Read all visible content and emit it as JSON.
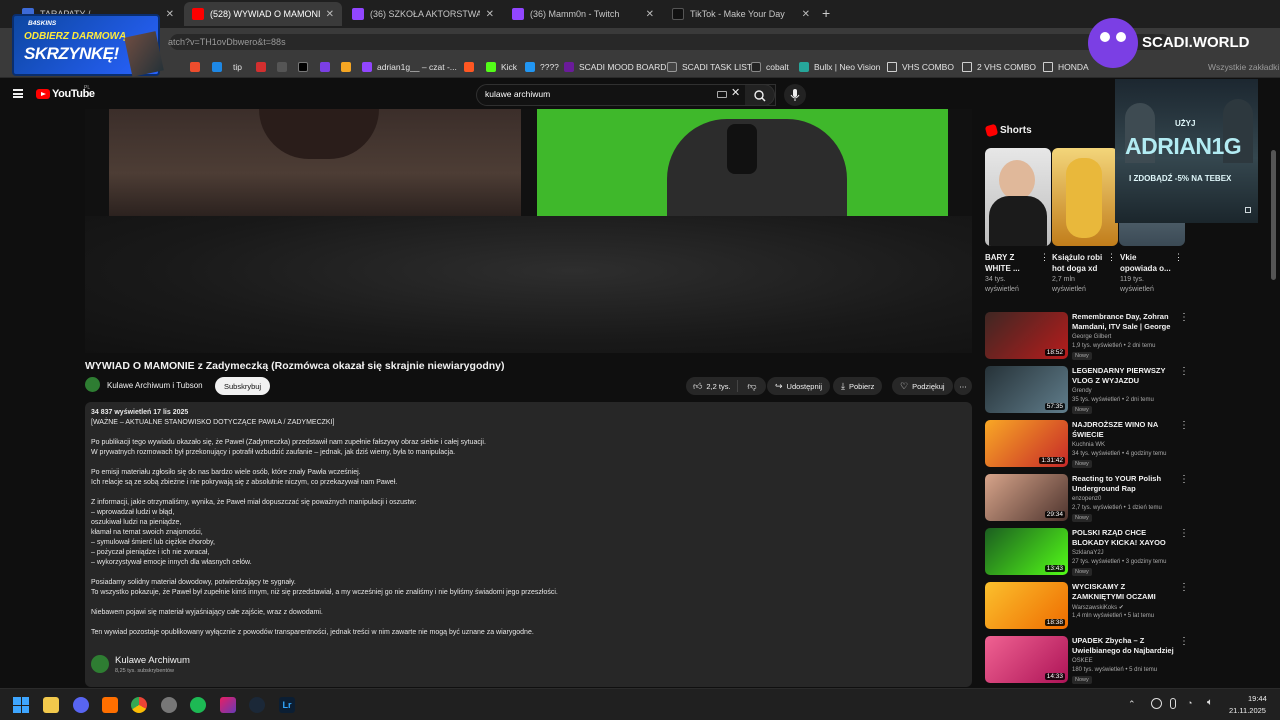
{
  "browser": {
    "tabs": [
      {
        "label": "TARAPATY / ...",
        "prefix": "",
        "active": false,
        "color": "#3d6bd8"
      },
      {
        "label": "(528) WYWIAD O MAMONIE z",
        "active": true,
        "color": "#ff0000"
      },
      {
        "label": "(36) SZKOŁA AKTORSTWA - Twi",
        "active": false,
        "color": "#9146ff"
      },
      {
        "label": "(36) Mamm0n - Twitch",
        "active": false,
        "color": "#9146ff"
      },
      {
        "label": "TikTok - Make Your Day",
        "active": false,
        "color": "#111111"
      }
    ],
    "new_tab_label": "+",
    "close_glyph": "✕",
    "address": "atch?v=TH1ovDbwero&t=88s",
    "bookmarks": [
      {
        "label": "",
        "color": "#ee4d2d"
      },
      {
        "label": "",
        "color": "#1e88e5"
      },
      {
        "label": "tip",
        "color": "#333333"
      },
      {
        "label": "",
        "color": "#d32f2f"
      },
      {
        "label": "",
        "color": "#555555"
      },
      {
        "label": "",
        "color": "#000000"
      },
      {
        "label": "",
        "color": "#7b3fe4"
      },
      {
        "label": "",
        "color": "#f5a623"
      },
      {
        "label": "adrian1g__ – czat -...",
        "color": "#9146ff"
      },
      {
        "label": "",
        "color": "#ff5722"
      },
      {
        "label": "Kick",
        "color": "#53fc18"
      },
      {
        "label": "????",
        "color": "#2196f3"
      },
      {
        "label": "SCADI MOOD BOARD",
        "color": "#6a1b9a"
      },
      {
        "label": "SCADI TASK LIST",
        "color": "#444444"
      },
      {
        "label": "cobalt",
        "color": "#222222"
      },
      {
        "label": "Bullx | Neo Vision",
        "color": "#26a69a"
      },
      {
        "label": "VHS COMBO",
        "color": "#8d8d8d"
      },
      {
        "label": "2 VHS COMBO",
        "color": "#8d8d8d"
      },
      {
        "label": "HONDA",
        "color": "#8d8d8d"
      }
    ],
    "all_bookmarks": "Wszystkie zakładki"
  },
  "overlay": {
    "promo_brand": "B4SKINS",
    "promo_line1": "ODBIERZ DARMOWĄ",
    "promo_line2": "SKRZYNKĘ!",
    "scadi_label": "SCADI.WORLD",
    "ad_small": "UŻYJ",
    "ad_code": "ADRIAN1G",
    "ad_offer": "I ZDOBĄDŹ -5% NA TEBEX"
  },
  "youtube": {
    "logo": "YouTube",
    "logo_country": "PL",
    "search_value": "kulawe archiwum",
    "video_title": "WYWIAD O MAMONIE z Zadymeczką (Rozmówca okazał się skrajnie niewiarygodny)",
    "channel": "Kulawe Archiwum i Tubson",
    "subscribe": "Subskrybuj",
    "likes": "2,2 tys.",
    "share": "Udostępnij",
    "download": "Pobierz",
    "thanks": "Podziękuj",
    "more": "⋯",
    "description": {
      "stats": "34 837 wyświetleń  17 lis 2025",
      "lines": [
        "[WAŻNE – AKTUALNE STANOWISKO DOTYCZĄCE PAWŁA / ZADYMECZKI]",
        "",
        "Po publikacji tego wywiadu okazało się, że Paweł (Zadymeczka) przedstawił nam zupełnie fałszywy obraz siebie i całej sytuacji.",
        "W prywatnych rozmowach był przekonujący i potrafił wzbudzić zaufanie – jednak, jak dziś wiemy, była to manipulacja.",
        "",
        "Po emisji materiału zgłosiło się do nas bardzo wiele osób, które znały Pawła wcześniej.",
        "Ich relacje są ze sobą zbieżne i nie pokrywają się z absolutnie niczym, co przekazywał nam Paweł.",
        "",
        "Z informacji, jakie otrzymaliśmy, wynika, że Paweł miał dopuszczać się poważnych manipulacji i oszustw:",
        "– wprowadzał ludzi w błąd,",
        "oszukiwał ludzi na pieniądze,",
        "kłamał na temat swoich znajomości,",
        "– symulował śmierć lub ciężkie choroby,",
        "– pożyczał pieniądze i ich nie zwracał,",
        "– wykorzystywał emocje innych dla własnych celów.",
        "",
        "Posiadamy solidny materiał dowodowy, potwierdzający te sygnały.",
        "To wszystko pokazuje, że Paweł był zupełnie kimś innym, niż się przedstawiał, a my wcześniej go nie znaliśmy i nie byliśmy świadomi jego przeszłości.",
        "",
        "Niebawem pojawi się materiał wyjaśniający całe zajście, wraz z dowodami.",
        "",
        "Ten wywiad pozostaje opublikowany wyłącznie z powodów transparentności, jednak treści w nim zawarte nie mogą być uznane za wiarygodne."
      ],
      "channel_name": "Kulawe Archiwum",
      "channel_subs": "8,25 tys. subskrybentów"
    },
    "shorts_title": "Shorts",
    "shorts": [
      {
        "title": "BARY Z WHITE ...",
        "views": "34 tys. wyświetleń",
        "color": "#cfcfcf"
      },
      {
        "title": "Książulo robi hot doga xd",
        "views": "2,7 mln wyświetleń",
        "color": "#d6a12a"
      },
      {
        "title": "Vkie opowiada o...",
        "views": "119 tys. wyświetleń",
        "color": "#5b6e7c"
      }
    ],
    "recommended": [
      {
        "title": "Remembrance Day, Zohran Mamdani, ITV Sale | George ...",
        "channel": "George Gilbert",
        "meta": "1,9 tys. wyświetleń • 2 dni temu",
        "badge": "Nowy",
        "duration": "18:52",
        "color": "#b71c1c"
      },
      {
        "title": "LEGENDARNY PIERWSZY VLOG Z WYJAZDU",
        "channel": "Grendy",
        "meta": "35 tys. wyświetleń • 2 dni temu",
        "badge": "Nowy",
        "duration": "57:35",
        "color": "#455a64"
      },
      {
        "title": "NAJDROŻSZE WINO NA ŚWIECIE",
        "channel": "Kuchnia WK",
        "meta": "34 tys. wyświetleń • 4 godziny temu",
        "badge": "Nowy",
        "duration": "1:31:42",
        "color": "#c62828"
      },
      {
        "title": "Reacting to YOUR Polish Underground Rap Suggestions!",
        "channel": "enzopenz0",
        "meta": "2,7 tys. wyświetleń • 1 dzień temu",
        "badge": "Nowy",
        "duration": "29:34",
        "color": "#4e342e"
      },
      {
        "title": "POLSKI RZĄD CHCE BLOKADY KICKA! XAYOO vs BANDURA!? ...",
        "channel": "SzklanaY2J",
        "meta": "27 tys. wyświetleń • 3 godziny temu",
        "badge": "Nowy",
        "duration": "13:43",
        "color": "#2e7d32"
      },
      {
        "title": "WYCISKAMY Z ZAMKNIĘTYMI OCZAMI *Błąd Owcy*",
        "channel": "WarszawskiKoks ✔",
        "meta": "1,4 mln wyświetleń • 5 lat temu",
        "badge": "",
        "duration": "18:38",
        "color": "#ef6c00"
      },
      {
        "title": "UPADEK Zbycha – Z Uwielbianego do Najbardziej ...",
        "channel": "OSKEE",
        "meta": "180 tys. wyświetleń • 5 dni temu",
        "badge": "Nowy",
        "duration": "14:33",
        "color": "#ad1457"
      }
    ]
  },
  "taskbar": {
    "time": "19:44",
    "date": "21.11.2025",
    "app_colors": [
      "#0078d4",
      "#f2c94c",
      "#5865f2",
      "#ff6f00",
      "#4285f4",
      "#777777",
      "#1db954",
      "#a020f0",
      "#1b2838",
      "#31a8ff"
    ]
  }
}
